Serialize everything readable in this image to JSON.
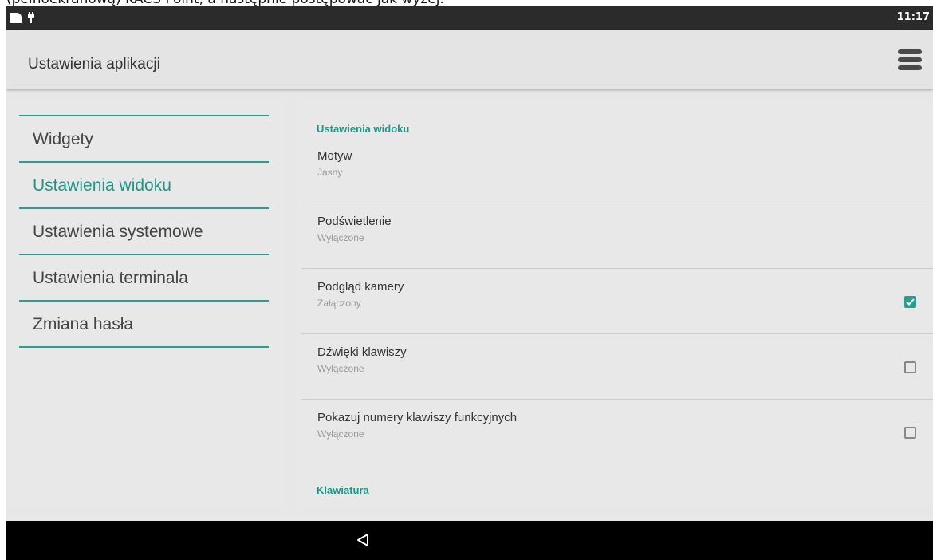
{
  "caption": "(pełnoekranową) KACS Point, a następnie postępować jak wyżej.",
  "status_bar": {
    "time": "11:17"
  },
  "app_bar": {
    "title": "Ustawienia aplikacji",
    "menu_icon": "hamburger-menu-icon"
  },
  "nav": {
    "items": [
      {
        "label": "Widgety",
        "active": false
      },
      {
        "label": "Ustawienia widoku",
        "active": true
      },
      {
        "label": "Ustawienia systemowe",
        "active": false
      },
      {
        "label": "Ustawienia terminala",
        "active": false
      },
      {
        "label": "Zmiana hasła",
        "active": false
      }
    ]
  },
  "settings": {
    "section_title": "Ustawienia widoku",
    "items": [
      {
        "title": "Motyw",
        "summary": "Jasny"
      },
      {
        "title": "Podświetlenie",
        "summary": "Wyłączone"
      },
      {
        "title": "Podgląd kamery",
        "summary": "Załączony",
        "checked": true
      },
      {
        "title": "Dźwięki klawiszy",
        "summary": "Wyłączone",
        "checked": false
      },
      {
        "title": "Pokazuj numery klawiszy funkcyjnych",
        "summary": "Wyłączone",
        "checked": false
      }
    ],
    "next_section_title": "Klawiatura"
  },
  "colors": {
    "accent": "#2b9c91",
    "status_bar": "#2b2b2b",
    "nav_bar": "#000000",
    "background": "#e7e7e7"
  }
}
